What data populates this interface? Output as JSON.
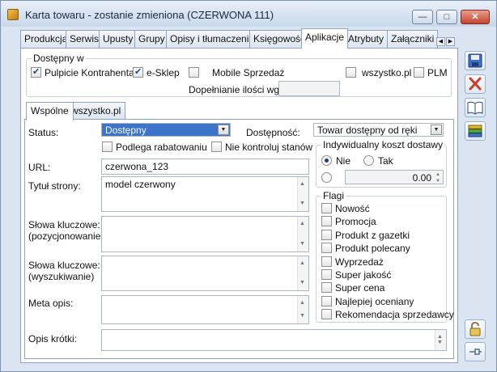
{
  "window": {
    "title": "Karta towaru - zostanie zmieniona (CZERWONA 111)",
    "minimize": "—",
    "maximize": "□",
    "close": "✕"
  },
  "tabs": [
    "Produkcja",
    "Serwis",
    "Upusty",
    "Grupy",
    "Opisy i tłumaczenia",
    "Księgowość",
    "Aplikacje",
    "Atrybuty",
    "Załączniki"
  ],
  "active_tab": "Aplikacje",
  "dostepny": {
    "title": "Dostępny w",
    "pulpicie": "Pulpicie Kontrahenta",
    "esklep": "e-Sklep",
    "mobile": "Mobile Sprzedaż",
    "wszystko": "wszystko.pl",
    "plm": "PLM",
    "dopelnianie_label": "Dopełnianie ilości wg:",
    "dopelnianie_value": "",
    "checked": {
      "pulpicie": true,
      "esklep": true,
      "mobile": false,
      "wszystko": false,
      "plm": false
    }
  },
  "subtabs": [
    "Wspólne",
    "wszystko.pl"
  ],
  "form": {
    "status_label": "Status:",
    "status_value": "Dostępny",
    "dostepnosc_label": "Dostępność:",
    "dostepnosc_value": "Towar dostępny od ręki",
    "podlega": "Podlega rabatowaniu",
    "nie_kontroluj": "Nie kontroluj stanów",
    "url_label": "URL:",
    "url_value": "czerwona_123",
    "tytul_label": "Tytuł strony:",
    "tytul_value": "model czerwony",
    "slowa_poz_label_1": "Słowa kluczowe:",
    "slowa_poz_label_2": "(pozycjonowanie)",
    "slowa_wysz_label_1": "Słowa kluczowe:",
    "slowa_wysz_label_2": "(wyszukiwanie)",
    "meta_label": "Meta opis:",
    "opis_label": "Opis krótki:"
  },
  "koszt": {
    "title": "Indywidualny koszt dostawy",
    "nie": "Nie",
    "tak": "Tak",
    "value": "0.00"
  },
  "flagi": {
    "title": "Flagi",
    "items": [
      "Nowość",
      "Promocja",
      "Produkt z gazetki",
      "Produkt polecany",
      "Wyprzedaż",
      "Super jakość",
      "Super cena",
      "Najlepiej oceniany",
      "Rekomendacja sprzedawcy"
    ]
  },
  "icons": {
    "save": "floppy-disk-icon",
    "cancel": "cross-icon",
    "book": "book-icon",
    "list": "list-icon",
    "lock": "lock-icon",
    "pin": "pin-icon"
  },
  "colors": {
    "accent": "#3b74c9",
    "cancel": "#d23a2a",
    "frame": "#dbe5f2"
  }
}
